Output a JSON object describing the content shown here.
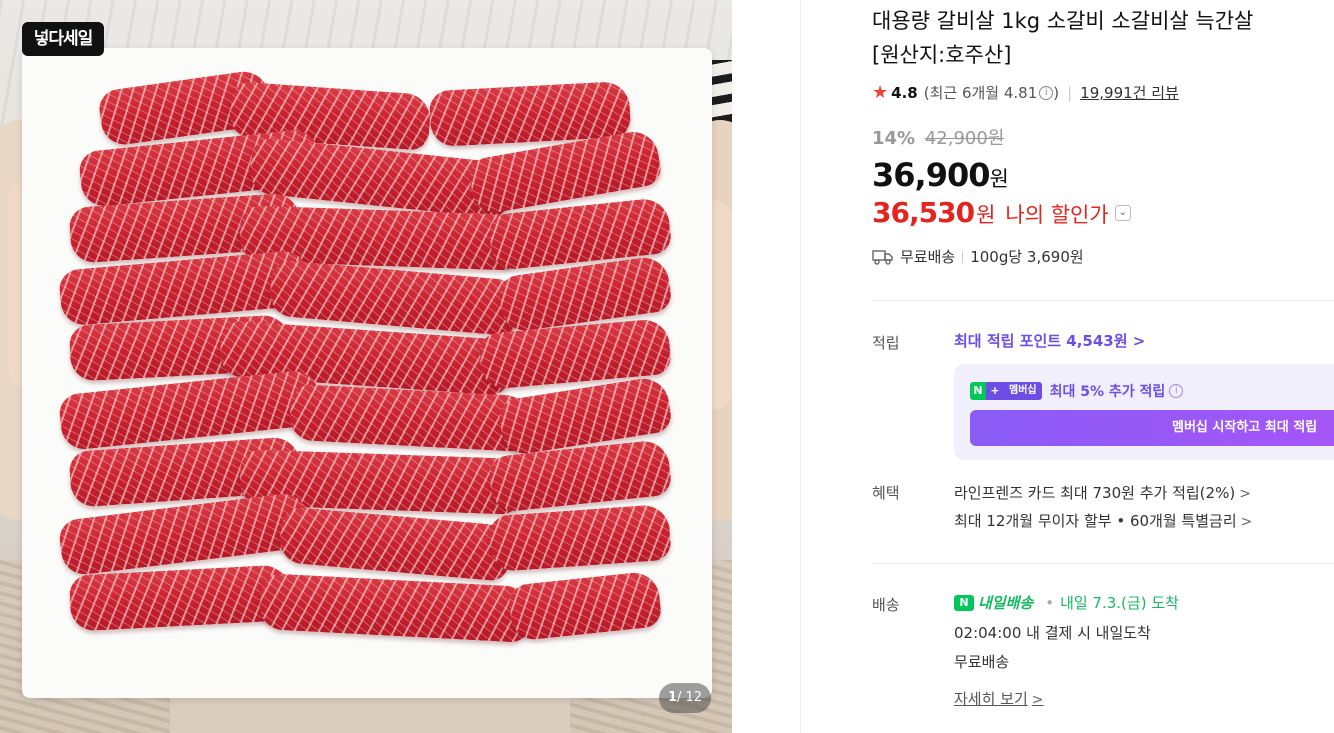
{
  "gallery": {
    "badge": "넣다세일",
    "counter_current": "1",
    "counter_total": "/ 12"
  },
  "product": {
    "title_line1": "대용량 갈비살 1kg 소갈비 소갈비살 늑간살",
    "title_line2": "[원산지:호주산]",
    "rating": "4.8",
    "recent_rating": "(최근 6개월 4.81",
    "recent_close": ")",
    "review_count": "19,991건 리뷰",
    "discount_pct": "14%",
    "original_price": "42,900원",
    "price": "36,900",
    "price_unit": "원",
    "my_price": "36,530",
    "my_price_unit": "원",
    "my_price_label": "나의 할인가",
    "shipping": "무료배송",
    "unit_price": "100g당 3,690원"
  },
  "points": {
    "label": "적립",
    "link": "최대 적립 포인트 4,543원 >",
    "membership_badge_n": "N",
    "membership_badge_plus": "+",
    "membership_badge_text": "멤버십",
    "membership_text_bold": "최대 5% 추가 적립",
    "membership_button": "멤버십 시작하고 최대 적립"
  },
  "benefits": {
    "label": "혜택",
    "items": [
      "라인프렌즈 카드 최대 730원 추가 적립(2%)",
      "최대 12개월 무이자 할부 • 60개월 특별금리"
    ]
  },
  "delivery": {
    "label": "배송",
    "brand_logo": "N",
    "brand": "내일배송",
    "eta": "내일 7.3.(금) 도착",
    "cutoff": "02:04:00  내 결제 시 내일도착",
    "fee": "무료배송",
    "detail_link": "자세히 보기"
  },
  "colors": {
    "discount_red": "#e5231f",
    "naver_green": "#03c75a",
    "membership_purple": "#6c4ee6"
  }
}
